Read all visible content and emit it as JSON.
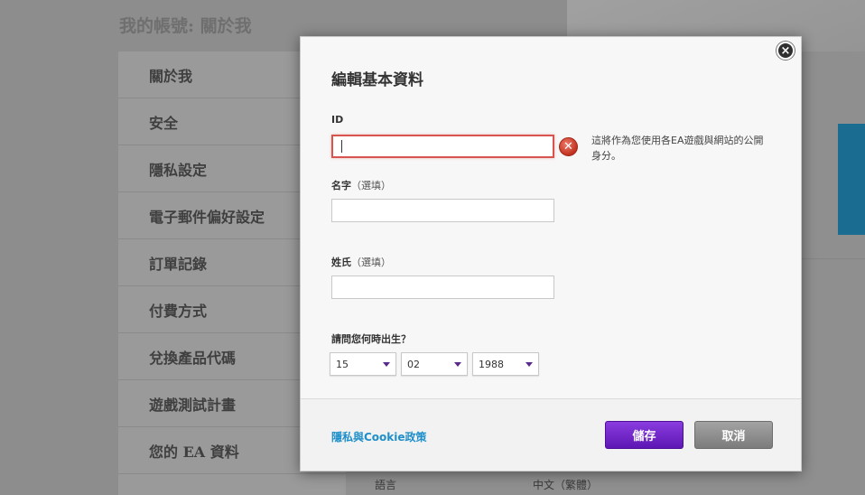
{
  "background": {
    "page_title": "我的帳號: 關於我",
    "sidebar": [
      {
        "label": "關於我"
      },
      {
        "label": "安全"
      },
      {
        "label": "隱私設定"
      },
      {
        "label": "電子郵件偏好設定"
      },
      {
        "label": "訂單記錄"
      },
      {
        "label": "付費方式"
      },
      {
        "label": "兌換產品代碼"
      },
      {
        "label": "遊戲測試計畫"
      },
      {
        "label": "您的 EA 資料"
      }
    ],
    "language_label": "語言",
    "language_value": "中文（繁體）"
  },
  "modal": {
    "title": "編輯基本資料",
    "close_symbol": "×",
    "id_label": "ID",
    "id_value": "",
    "id_error_symbol": "✕",
    "id_help": "這將作為您使用各EA遊戲與網站的公開身分。",
    "first_name_label": "名字",
    "first_name_optional": "（選填）",
    "first_name_value": "",
    "last_name_label": "姓氏",
    "last_name_optional": "（選填）",
    "last_name_value": "",
    "dob_label": "請問您何時出生？",
    "dob_day": "15",
    "dob_month": "02",
    "dob_year": "1988",
    "policy_link": "隱私與Cookie政策",
    "save_label": "儲存",
    "cancel_label": "取消"
  },
  "colors": {
    "save_button": "#6a22c6",
    "cancel_button": "#8f8f8f",
    "error": "#d9534f",
    "link": "#1f8fc9"
  }
}
